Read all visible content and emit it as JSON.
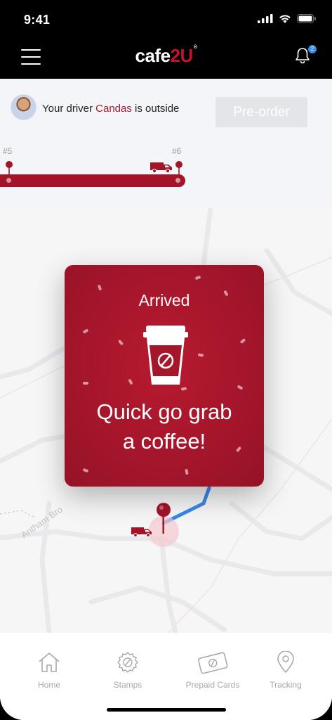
{
  "status": {
    "time": "9:41"
  },
  "nav": {
    "logo_main": "cafe",
    "logo_accent": "2U",
    "logo_reg": "®",
    "notification_count": "2"
  },
  "driver": {
    "prefix": "Your driver ",
    "name": "Candas",
    "suffix": " is outside",
    "preorder_label": "Pre-order"
  },
  "route": {
    "previous_stop": "#5",
    "next_stop": "#6"
  },
  "map": {
    "street_label": "Antham Bro"
  },
  "arrived": {
    "title": "Arrived",
    "message_line1": "Quick go grab",
    "message_line2": "a coffee!"
  },
  "tabs": [
    {
      "label": "Home",
      "icon": "home-icon"
    },
    {
      "label": "Stamps",
      "icon": "stamp-icon"
    },
    {
      "label": "Prepaid Cards",
      "icon": "prepaid-card-icon"
    },
    {
      "label": "Tracking",
      "icon": "location-pin-icon"
    }
  ],
  "colors": {
    "brand_red": "#a5162b",
    "route_blue": "#3b88e6",
    "muted_gray": "#a9a9ad"
  }
}
